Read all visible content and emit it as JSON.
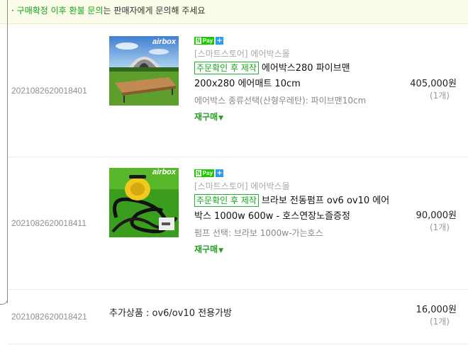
{
  "notice": {
    "bullet": "·",
    "highlight": "구매확정 이후 환불 문의",
    "rest": "는 판매자에게 문의해 주세요"
  },
  "npay": {
    "n": "N",
    "pay": "Pay",
    "plus": "+"
  },
  "orders": [
    {
      "order_no": "2021082620018401",
      "image_label": "airbox",
      "store": "[스마트스토어] 에어박스몰",
      "badge": "주문확인 후 제작",
      "title": "에어박스280 파이브맨 200x280 에어매트 10cm",
      "option": "에어박스 종류선택(산형우레탄): 파이브맨10cm",
      "rebuy": "재구매",
      "price": "405,000원",
      "qty": "(1개)"
    },
    {
      "order_no": "2021082620018411",
      "image_label": "airbox",
      "store": "[스마트스토어] 에어박스몰",
      "badge": "주문확인 후 제작",
      "title": "브라보 전동펌프 ov6 ov10 에어박스 1000w 600w - 호스연장노즐증정",
      "option": "펌프 선택: 브라보 1000w-가는호스",
      "rebuy": "재구매",
      "price": "90,000원",
      "qty": "(1개)"
    },
    {
      "order_no": "2021082620018421",
      "addon": "추가상품 : ov6/ov10 전용가방",
      "price": "16,000원",
      "qty": "(1개)"
    }
  ],
  "colors": {
    "accent_green": "#13a318",
    "notice_bg": "#fafce9",
    "npay_green": "#1ec800",
    "plus_blue": "#2d9bf0"
  }
}
